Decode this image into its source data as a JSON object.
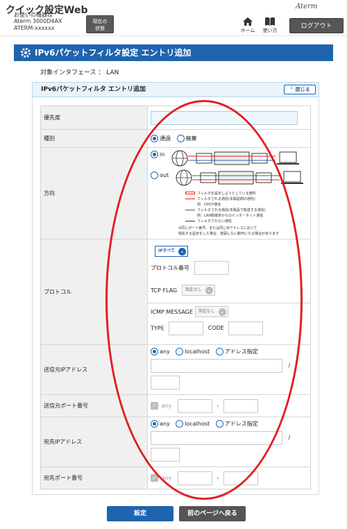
{
  "header": {
    "app_title": "クイック設定Web",
    "device_caption": "お使いの機器は",
    "device_model": "Aterm 3000D4AX",
    "device_id": "ATERM-xxxxxx",
    "status_btn_line1": "現在の",
    "status_btn_line2": "状態",
    "logo": "Aterm",
    "nav_home": "ホーム",
    "nav_help": "使い方",
    "logout": "ログアウト"
  },
  "page_title": "IPv6パケットフィルタ設定 エントリ追加",
  "interface_line": "対象インタフェース ： LAN",
  "panel": {
    "title": "IPv6パケットフィルタ エントリ追加",
    "collapse": "閉じる"
  },
  "form": {
    "priority": {
      "label": "優先度",
      "value": ""
    },
    "type": {
      "label": "種別",
      "options": [
        "通過",
        "廃棄"
      ],
      "selected": "通過"
    },
    "direction": {
      "label": "方向",
      "options": [
        "in",
        "out"
      ],
      "selected": "in",
      "device_label": "本製品",
      "legend": [
        "フィルタを設定しようとしている箇所",
        "フィルタされる通信(本製品側の通信)",
        "例：DHCP通信",
        "フィルタされる通信(本製品で転送する通信)",
        "例：LAN側端末からのインターネット通信",
        "フィルタされない通信"
      ],
      "note1": "※同じポート番号、または同じIPアドレスにおいて",
      "note2": "相反する設定をした場合、意図しない動作になる場合があります"
    },
    "protocol": {
      "label": "プロトコル",
      "ip_select": "IPすべて",
      "proto_num_label": "プロトコル番号",
      "tcp_flag_label": "TCP FLAG",
      "tcp_flag_value": "指定なし",
      "icmp_label": "ICMP MESSAGE",
      "icmp_value": "指定なし",
      "type_label": "TYPE",
      "code_label": "CODE"
    },
    "src_ip": {
      "label": "送信元IPアドレス",
      "options": [
        "any",
        "localhost",
        "アドレス指定"
      ],
      "selected": "any",
      "slash": "/"
    },
    "src_port": {
      "label": "送信元ポート番号",
      "any_label": "any",
      "dash": "-"
    },
    "dst_ip": {
      "label": "宛先IPアドレス",
      "options": [
        "any",
        "localhost",
        "アドレス指定"
      ],
      "selected": "any",
      "slash": "/"
    },
    "dst_port": {
      "label": "宛先ポート番号",
      "any_label": "any",
      "dash": "-"
    }
  },
  "buttons": {
    "set": "設定",
    "back": "前のページへ戻る"
  },
  "colors": {
    "primary": "#1f64ae",
    "annotation": "#e31e24"
  }
}
